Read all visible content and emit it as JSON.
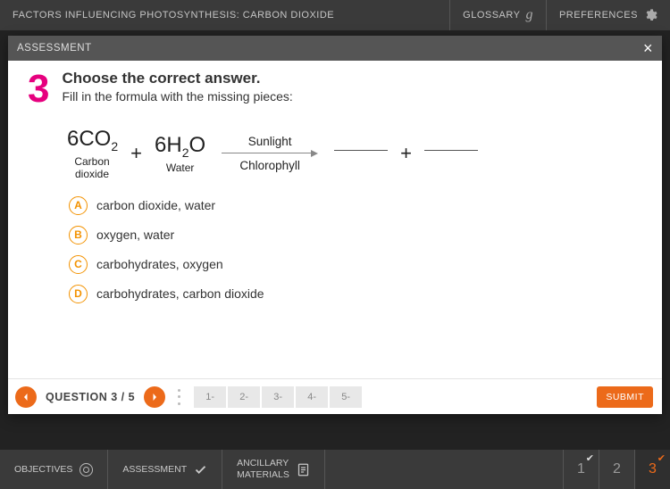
{
  "header": {
    "title": "FACTORS INFLUENCING PHOTOSYNTHESIS: CARBON DIOXIDE",
    "glossary": "GLOSSARY",
    "preferences": "PREFERENCES"
  },
  "panel": {
    "title": "ASSESSMENT"
  },
  "question": {
    "number": "3",
    "prompt_title": "Choose the correct answer.",
    "prompt_sub": "Fill in the formula with the missing pieces:"
  },
  "equation": {
    "co2_formula_a": "6CO",
    "co2_formula_sub": "2",
    "co2_label": "Carbon dioxide",
    "plus1": "+",
    "h2o_formula_a": "6H",
    "h2o_formula_sub": "2",
    "h2o_formula_b": "O",
    "h2o_label": "Water",
    "arrow_top": "Sunlight",
    "arrow_bottom": "Chlorophyll",
    "plus2": "+"
  },
  "options": [
    {
      "letter": "A",
      "text": "carbon dioxide, water"
    },
    {
      "letter": "B",
      "text": "oxygen, water"
    },
    {
      "letter": "C",
      "text": "carbohydrates, oxygen"
    },
    {
      "letter": "D",
      "text": "carbohydrates, carbon dioxide"
    }
  ],
  "footer": {
    "counter": "QUESTION 3 / 5",
    "nums": [
      "1-",
      "2-",
      "3-",
      "4-",
      "5-"
    ],
    "submit": "SUBMIT"
  },
  "bottom": {
    "objectives": "OBJECTIVES",
    "assessment": "ASSESSMENT",
    "ancillary_l1": "ANCILLARY",
    "ancillary_l2": "MATERIALS",
    "steps": [
      "1",
      "2",
      "3"
    ]
  }
}
